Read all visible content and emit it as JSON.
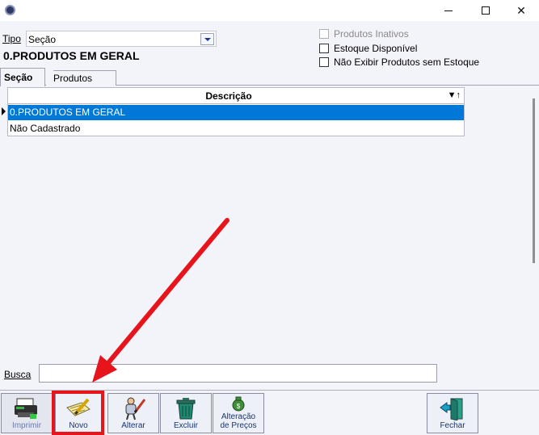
{
  "window": {
    "minimize_icon": "minimize-icon",
    "maximize_icon": "maximize-icon",
    "close_icon": "close-icon",
    "close_glyph": "✕"
  },
  "filter": {
    "tipo_label": "Tipo",
    "tipo_value": "Seção",
    "selected_title": "0.PRODUTOS EM GERAL",
    "checkboxes": [
      {
        "label": "Produtos Inativos",
        "checked": false,
        "enabled": false
      },
      {
        "label": "Estoque Disponível",
        "checked": false,
        "enabled": true
      },
      {
        "label": "Não Exibir Produtos sem Estoque",
        "checked": false,
        "enabled": true
      }
    ]
  },
  "tabs": [
    {
      "label": "Seção",
      "active": true
    },
    {
      "label": "Produtos",
      "active": false
    }
  ],
  "grid": {
    "header": "Descrição",
    "sort_glyph": "↵",
    "rows": [
      {
        "text": "0.PRODUTOS EM GERAL",
        "selected": true
      },
      {
        "text": "Não Cadastrado",
        "selected": false
      }
    ]
  },
  "search": {
    "label": "Busca",
    "value": ""
  },
  "toolbar": {
    "imprimir": "Imprimir",
    "novo": "Novo",
    "alterar": "Alterar",
    "excluir": "Excluir",
    "alteracao_line1": "Alteração",
    "alteracao_line2": "de Preços",
    "fechar": "Fechar"
  },
  "annotation": {
    "highlight_color": "#e8141c",
    "arrow_color": "#e8141c",
    "highlighted_button": "Novo"
  },
  "colors": {
    "selection": "#0078d7",
    "background": "#f3f3fa"
  }
}
